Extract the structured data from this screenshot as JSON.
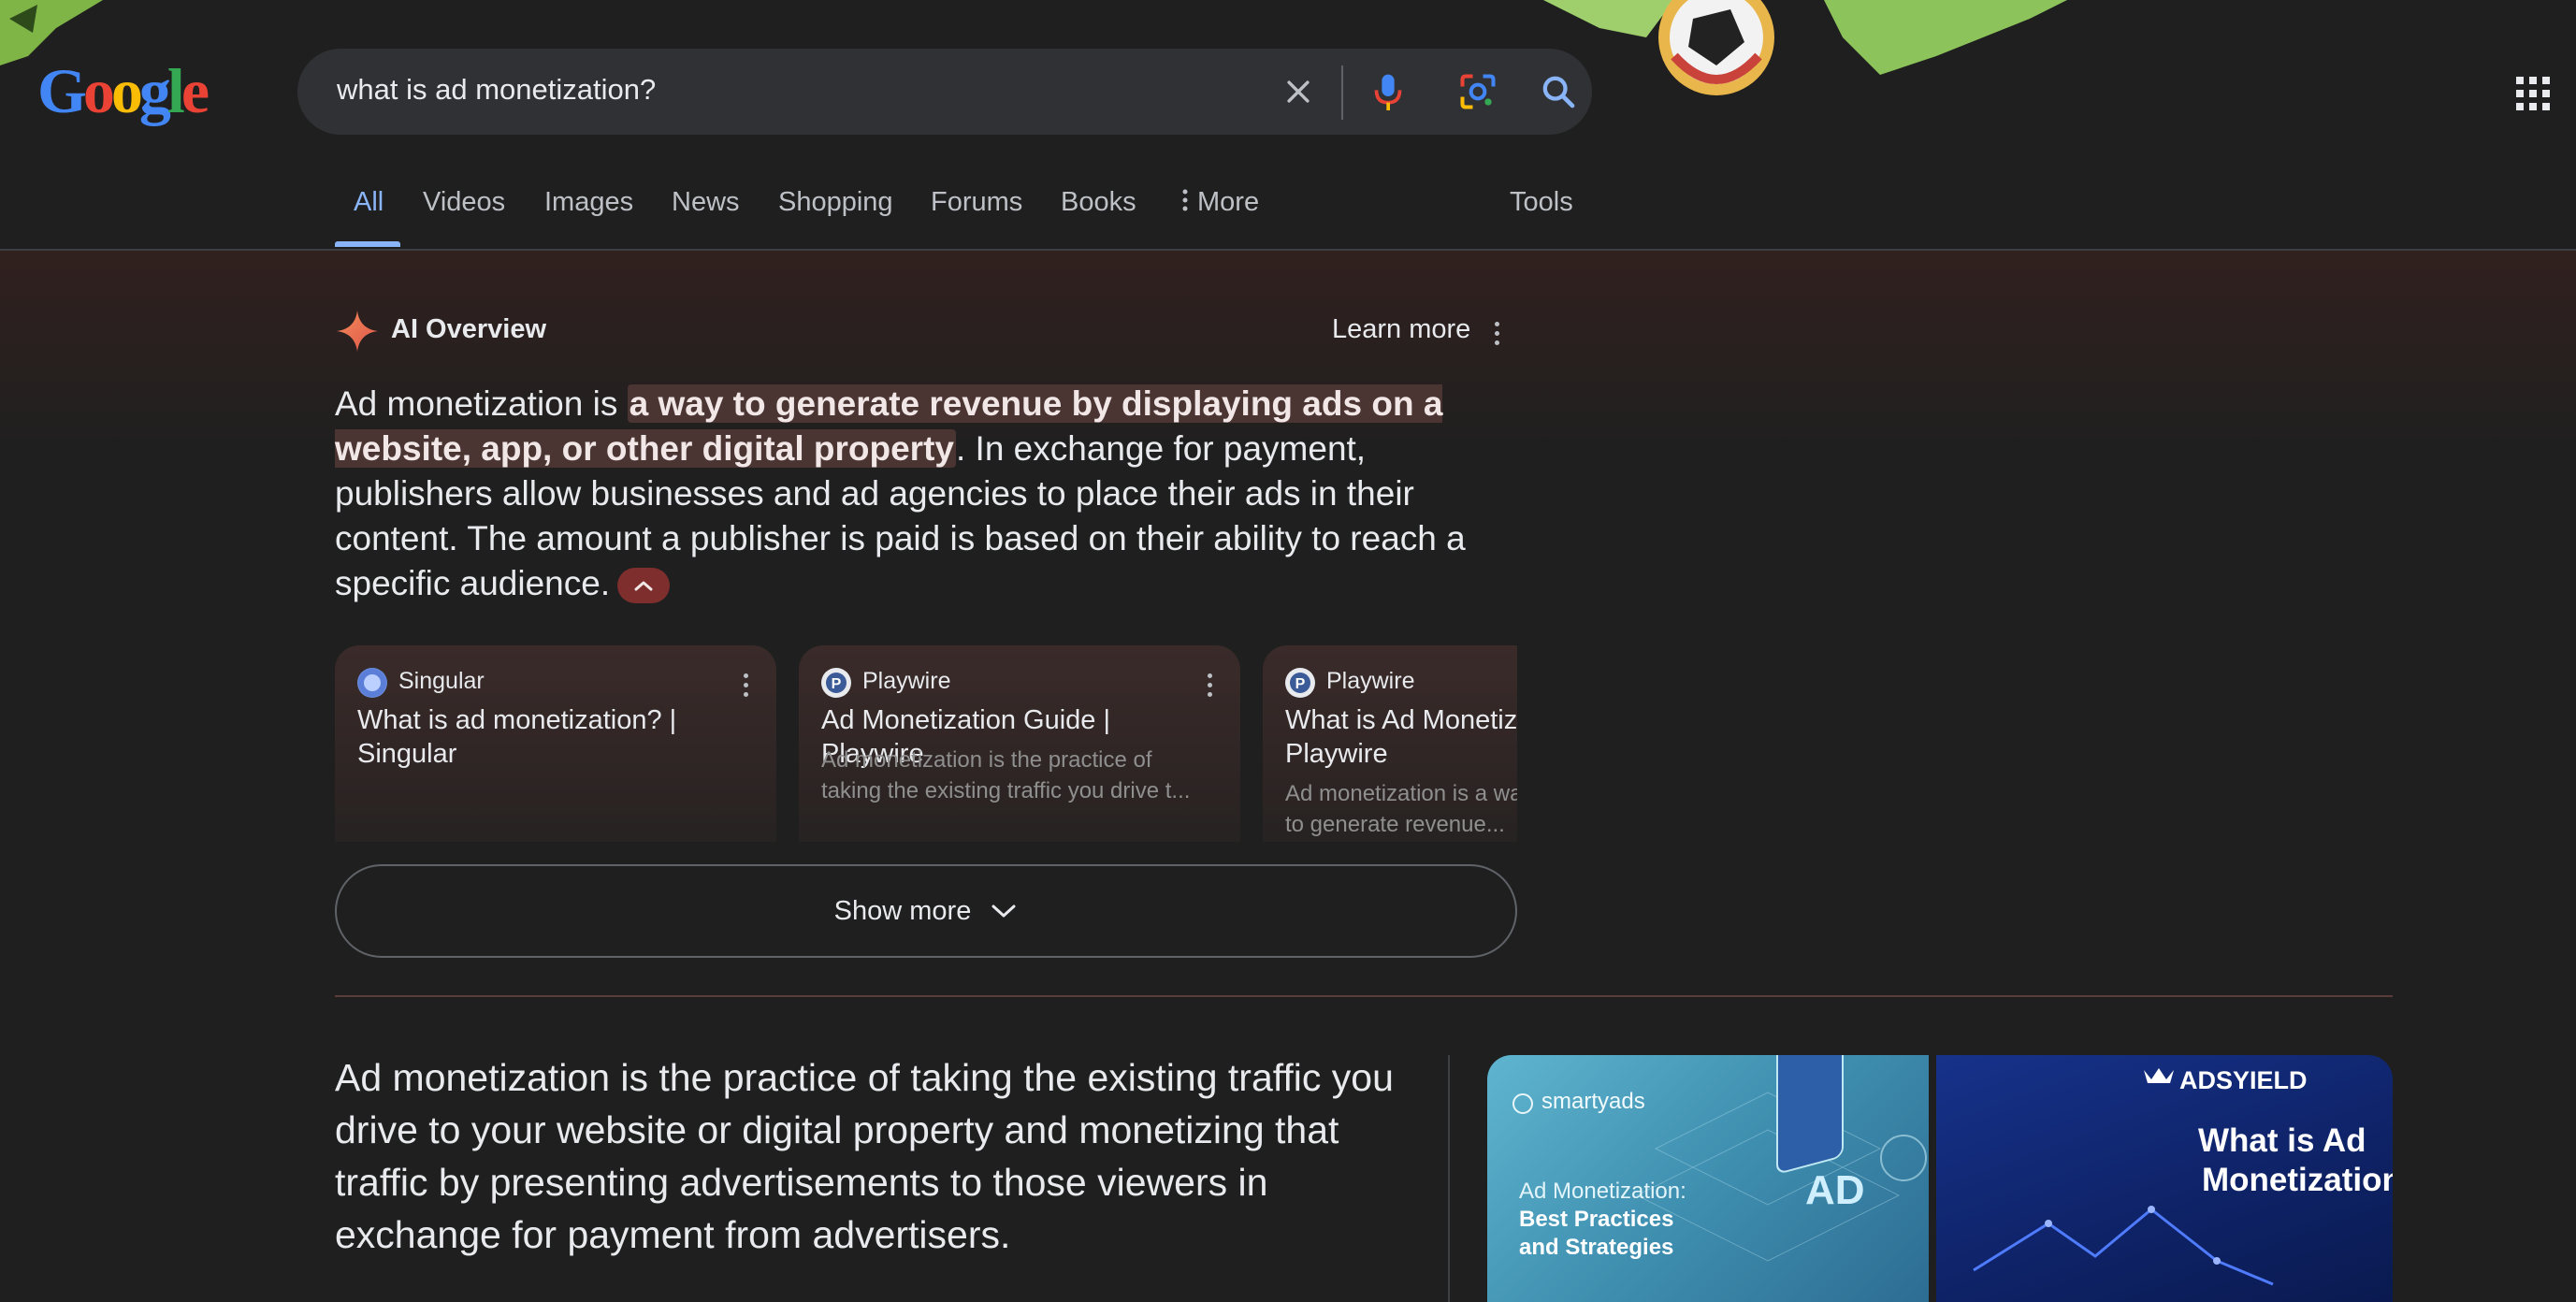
{
  "logo": {
    "letters": [
      "G",
      "o",
      "o",
      "g",
      "l",
      "e"
    ]
  },
  "search": {
    "query": "what is ad monetization?"
  },
  "tabs": [
    {
      "label": "All"
    },
    {
      "label": "Videos"
    },
    {
      "label": "Images"
    },
    {
      "label": "News"
    },
    {
      "label": "Shopping"
    },
    {
      "label": "Forums"
    },
    {
      "label": "Books"
    },
    {
      "label": "More"
    },
    {
      "label": "Tools"
    }
  ],
  "ai_overview": {
    "title": "AI Overview",
    "learn_more": "Learn more",
    "text_prefix": "Ad monetization is ",
    "text_highlight": "a way to generate revenue by displaying ads on a website, app, or other digital property",
    "text_suffix": ". In exchange for payment, publishers allow businesses and ad agencies to place their ads in their content. The amount a publisher is paid is based on their ability to reach a specific audience."
  },
  "cards": [
    {
      "source": "Singular",
      "title": "What is ad monetization? | Singular",
      "snippet": ""
    },
    {
      "source": "Playwire",
      "title": "Ad Monetization Guide | Playwire",
      "snippet": "Ad monetization is the practice of taking the existing traffic you drive t..."
    },
    {
      "source": "Playwire",
      "title": "What is Ad Monetization? | Playwire",
      "snippet": "Ad monetization is a way for publishers to generate revenue..."
    }
  ],
  "show_more": "Show more",
  "featured_snippet": {
    "text": "Ad monetization is the practice of taking the existing traffic you drive to your website or digital property and monetizing that traffic by presenting advertisements to those viewers in exchange for payment from advertisers."
  },
  "images": [
    {
      "brand": "smartyads",
      "line1": "Ad Monetization:",
      "line2": "Best Practices",
      "line3": "and Strategies",
      "badge": "AD"
    },
    {
      "brand": "ADSYIELD",
      "line1": "What is Ad",
      "line2": "Monetization"
    }
  ],
  "colors": {
    "accent": "#8ab4f8",
    "background": "#1f1f1f",
    "highlight": "#4a3533"
  }
}
